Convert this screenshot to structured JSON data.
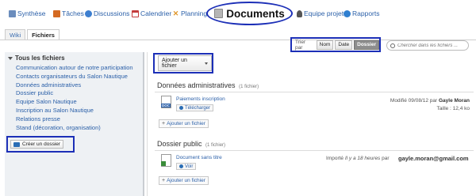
{
  "nav": {
    "items": [
      {
        "label": "Synthèse",
        "icon": "synthese-icon",
        "color": "#6b8dbd"
      },
      {
        "label": "Tâches",
        "icon": "tasks-icon",
        "color": "#d46a22"
      },
      {
        "label": "Discussions",
        "icon": "discussions-icon",
        "color": "#3d7fd0"
      },
      {
        "label": "Calendrier",
        "icon": "calendar-icon",
        "color": "#c43c3c"
      },
      {
        "label": "Planning",
        "icon": "planning-icon",
        "color": "#e0962a"
      },
      {
        "label": "Equipe projet",
        "icon": "team-icon",
        "color": "#555555"
      },
      {
        "label": "Rapports",
        "icon": "reports-icon",
        "color": "#2f7fd0"
      }
    ],
    "active": {
      "label": "Documents",
      "icon": "documents-icon"
    }
  },
  "tabs": [
    {
      "label": "Wiki",
      "active": false
    },
    {
      "label": "Fichiers",
      "active": true
    }
  ],
  "sort": {
    "label": "Trier par",
    "options": [
      {
        "label": "Nom",
        "active": false
      },
      {
        "label": "Date",
        "active": false
      },
      {
        "label": "Dossier",
        "active": true
      }
    ]
  },
  "search": {
    "placeholder": "Chercher dans les fichiers ..."
  },
  "sidebar": {
    "title": "Tous les fichiers",
    "items": [
      "Communication autour de notre participation",
      "Contacts organisateurs du Salon Nautique",
      "Données administratives",
      "Dossier public",
      "Equipe Salon Nautique",
      "Inscription au Salon Nautique",
      "Relations presse",
      "Stand (décoration, organisation)"
    ],
    "create_label": "Créer un dossier"
  },
  "main": {
    "add_file_label": "Ajouter un fichier",
    "sections": [
      {
        "title": "Données administratives",
        "count": "(1 fichier)",
        "file": {
          "name": "Paiements inscription",
          "badge": "DOC",
          "action": "Télécharger",
          "meta_line1_prefix": "Modifié 09/08/12 par",
          "meta_line1_user": "Gayle Moran",
          "meta_line2": "Taille : 12,4 ko"
        },
        "add_label": "Ajouter un fichier"
      },
      {
        "title": "Dossier public",
        "count": "(1 fichier)",
        "file": {
          "name": "Document sans titre",
          "action": "Voir",
          "meta_line1_prefix": "Importé",
          "meta_line1_italic": "Il y a 18 heures",
          "meta_line1_suffix": "par",
          "email": "gayle.moran@gmail.com"
        },
        "add_label": "Ajouter un fichier"
      }
    ]
  }
}
